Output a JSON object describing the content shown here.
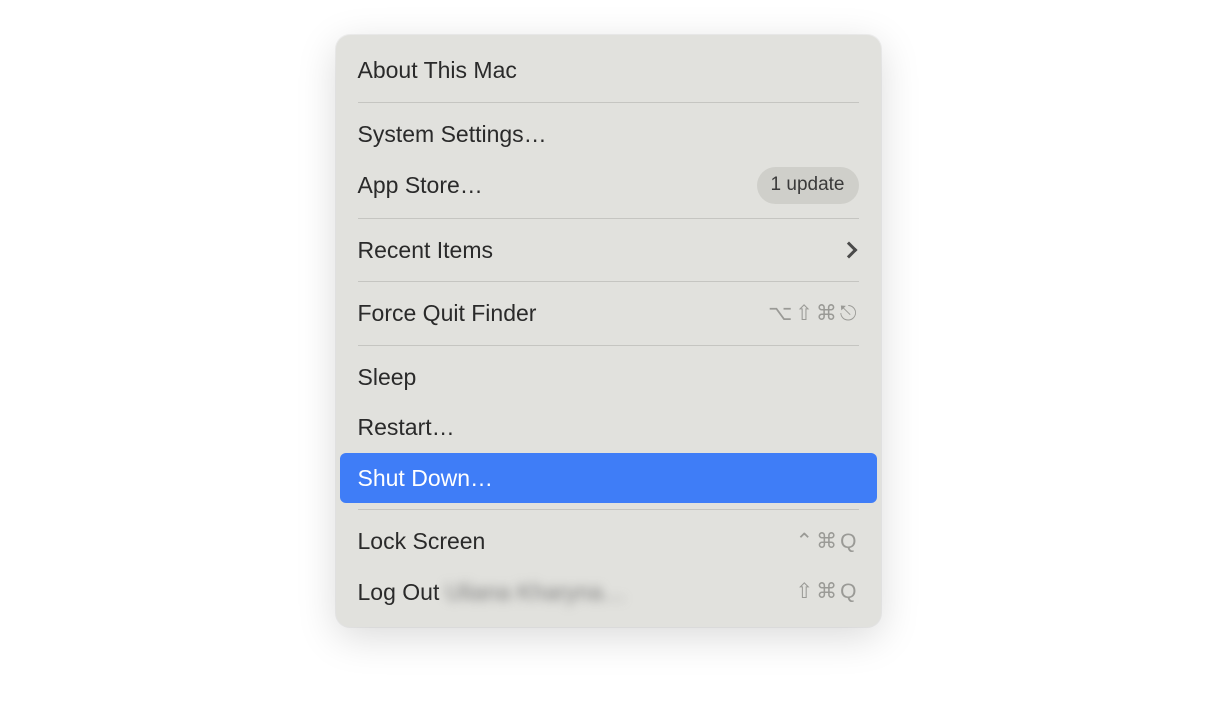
{
  "menu": {
    "about": "About This Mac",
    "systemSettings": "System Settings…",
    "appStore": "App Store…",
    "appStoreBadge": "1 update",
    "recentItems": "Recent Items",
    "forceQuit": "Force Quit Finder",
    "forceQuitShortcut": {
      "opt": "⌥",
      "shift": "⇧",
      "cmd": "⌘",
      "esc": "⎋"
    },
    "sleep": "Sleep",
    "restart": "Restart…",
    "shutDown": "Shut Down…",
    "lockScreen": "Lock Screen",
    "lockScreenShortcut": {
      "ctrl": "⌃",
      "cmd": "⌘",
      "key": "Q"
    },
    "logOut": "Log Out",
    "logOutUser": "Uliana Kharyna…",
    "logOutShortcut": {
      "shift": "⇧",
      "cmd": "⌘",
      "key": "Q"
    }
  }
}
